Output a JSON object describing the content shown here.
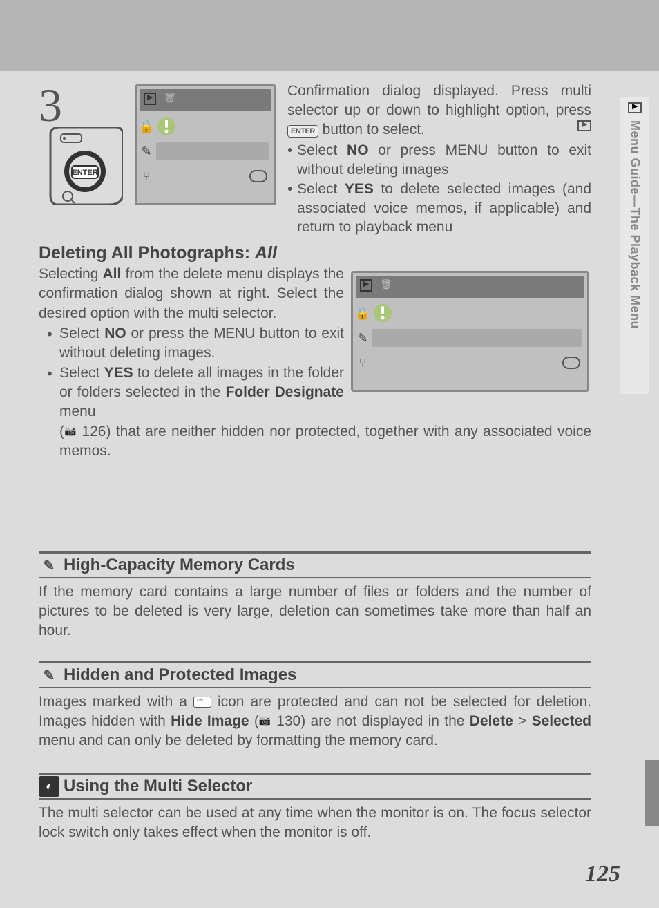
{
  "page_number": "125",
  "side_tab": "Menu Guide—The Playback Menu",
  "step": {
    "number": "3",
    "intro": "Confirmation dialog displayed.  Press multi selector up or down to highlight option, press ",
    "intro2": " button to select.",
    "enter_label": "ENTER",
    "bullets": [
      {
        "pre": "Select ",
        "bold": "NO",
        "post": " or press MENU button to exit without deleting images"
      },
      {
        "pre": "Select ",
        "bold": "YES",
        "post": " to delete selected images (and associated voice memos, if applicable) and return to playback menu"
      }
    ]
  },
  "delete_all": {
    "heading_a": "Deleting All Photographs: ",
    "heading_b": "All",
    "para": "Selecting All from the delete menu displays the confirmation dialog shown at right.  Select the desired option with the multi selector.",
    "bold_word": "All",
    "li1_pre": "Select ",
    "li1_bold": "NO",
    "li1_mid": " or press the ",
    "li1_menu": "MENU",
    "li1_post": " button to exit without deleting images.",
    "li2a_pre": "Select ",
    "li2a_bold": "YES",
    "li2a_mid": " to delete all images in the folder or folders selected in the ",
    "li2a_bold2": "Folder Designate",
    "li2a_post": " menu",
    "li2b_pre": "(",
    "li2b_pg": " 126) that are neither hidden nor protected, together with any associated voice memos.",
    "li2b_icon": "book"
  },
  "notes": [
    {
      "icon": "pencil",
      "title": "High-Capacity Memory Cards",
      "body": "If the memory card contains a large number of files or folders and the number of pictures to be deleted is very large, deletion can sometimes take more than half an hour."
    },
    {
      "icon": "pencil",
      "title": "Hidden and Protected Images",
      "body_parts": {
        "a": "Images marked with a ",
        "b": " icon are protected and can not be selected for deletion. Images hidden with ",
        "c": "Hide Image",
        "d": " (",
        "e": " 130) are not displayed in the ",
        "f": "Delete",
        "g": " > ",
        "h": "Selected",
        "i": " menu and can only be deleted by formatting the memory card."
      }
    },
    {
      "icon": "lamp",
      "title": "Using the Multi Selector",
      "body": "The multi selector can be used at any time when the monitor is on.  The focus selector lock switch only takes effect when the monitor is off."
    }
  ]
}
